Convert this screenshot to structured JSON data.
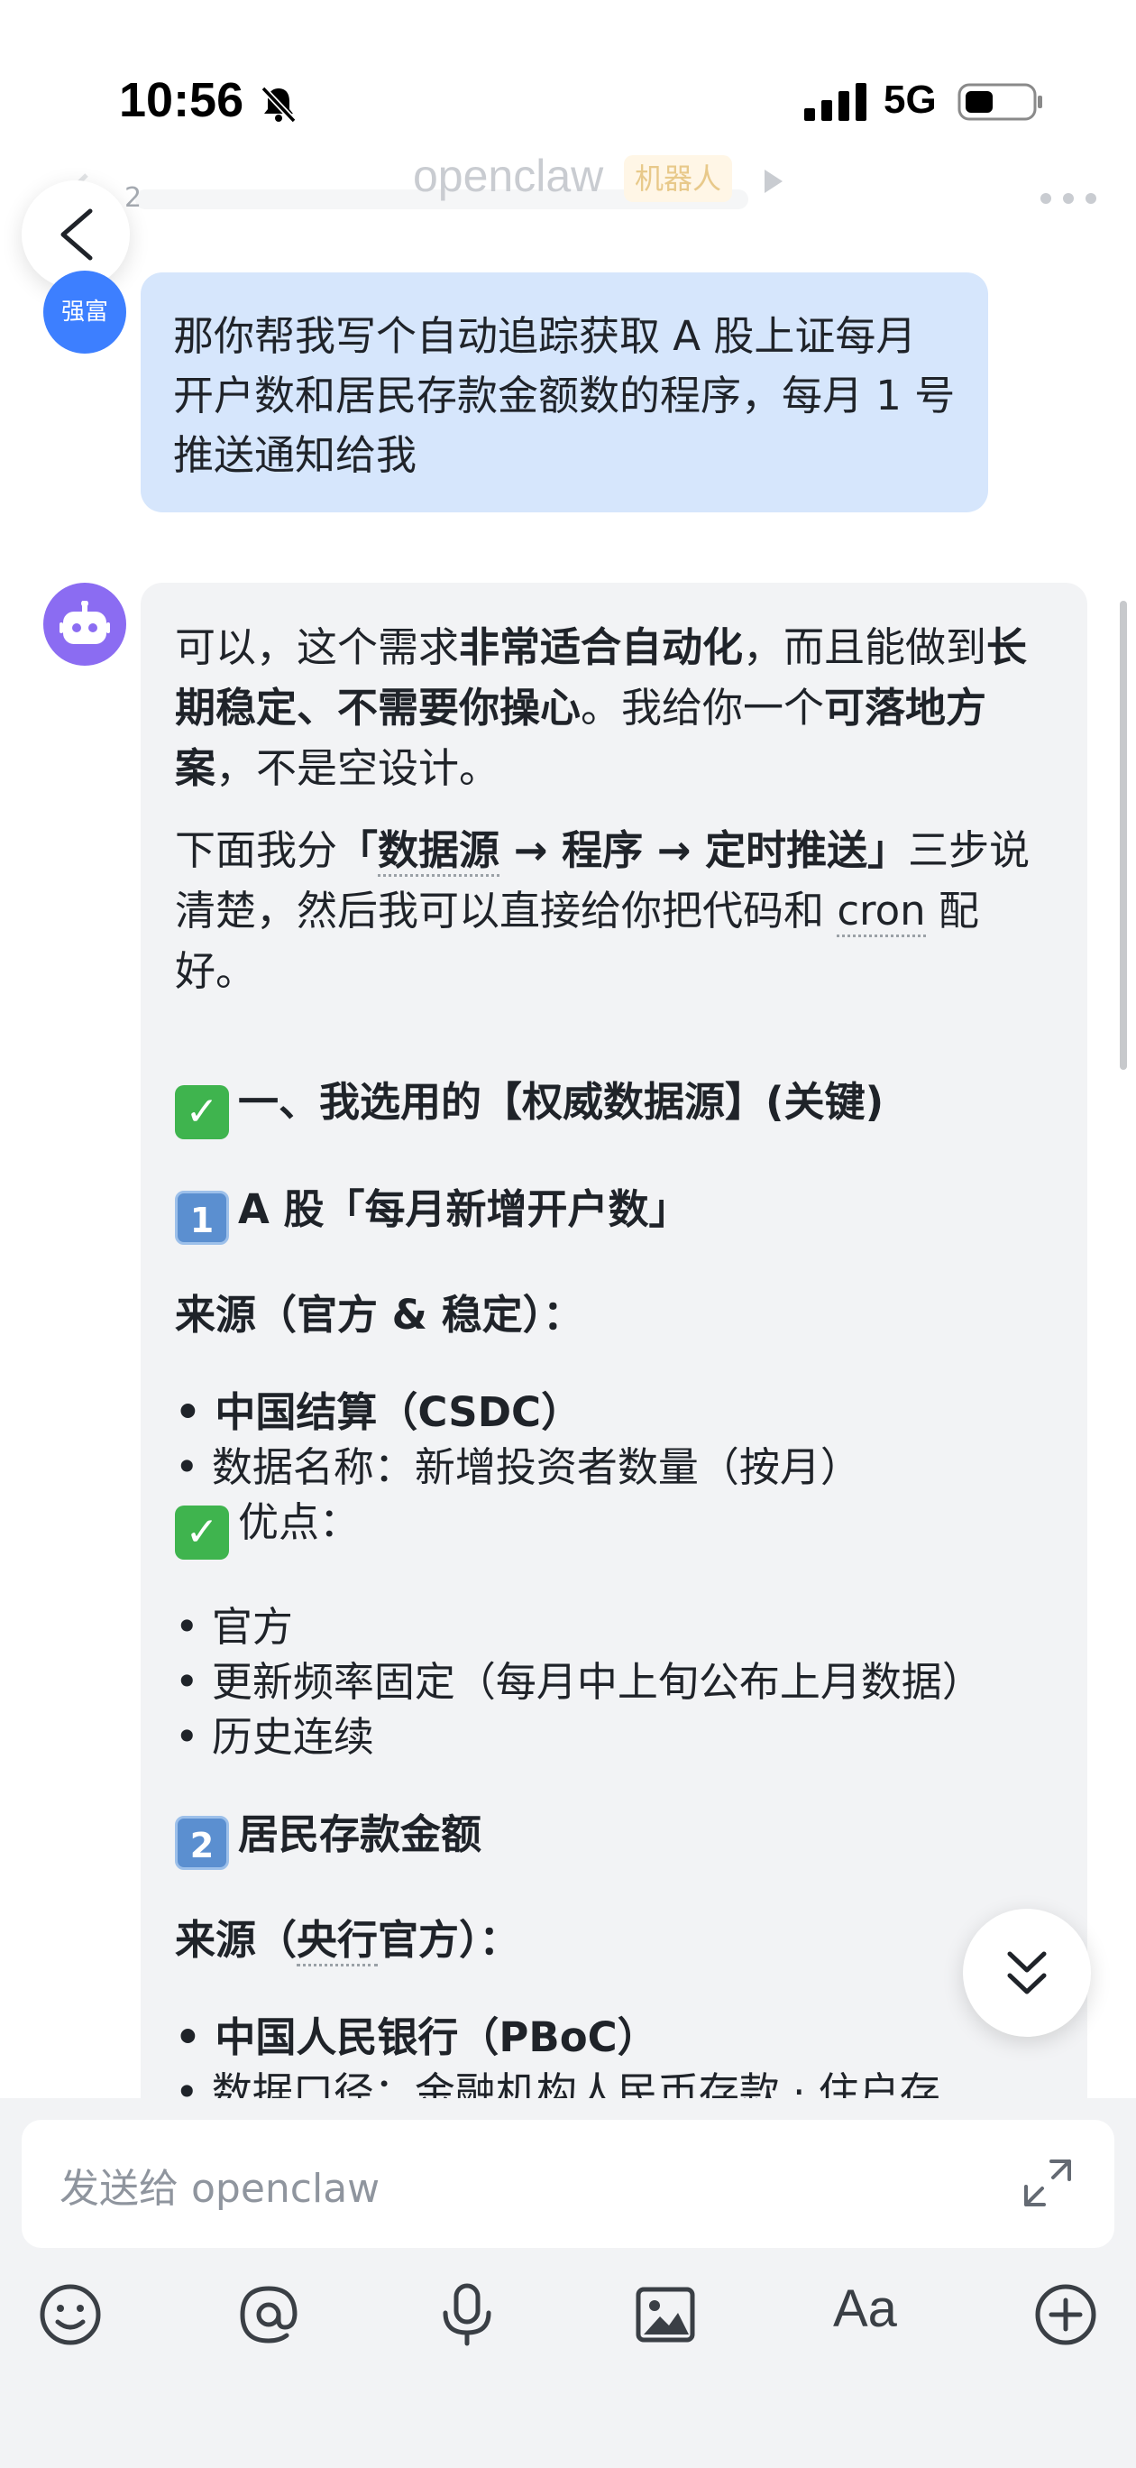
{
  "status_bar": {
    "time": "10:56",
    "network": "5G"
  },
  "header": {
    "unread_count": "2",
    "title": "openclaw",
    "badge": "机器人"
  },
  "user_message": {
    "avatar_text": "强富",
    "text": "那你帮我写个自动追踪获取 A 股上证每月开户数和居民存款金额数的程序，每月 1 号推送通知给我"
  },
  "bot_message": {
    "p1": {
      "a": "可以，这个需求",
      "b": "非常适合自动化",
      "c": "，而且能做到",
      "d": "长期稳定、不需要你操心",
      "e": "。我给你一个",
      "f": "可落地方案",
      "g": "，不是空设计。"
    },
    "p2": {
      "a": "下面我分",
      "b_pre": "「",
      "b_link": "数据源",
      "b_post": " → 程序 → 定时推送」",
      "c": "三步说清楚，然后我可以直接给你把代码和 ",
      "cron": "cron",
      "d": " 配好。"
    },
    "section1": {
      "emoji": "✓",
      "title": "一、我选用的【权威数据源】(关键)"
    },
    "item1": {
      "num": "1",
      "title": "A 股「每月新增开户数」",
      "source_title": "来源（官方 & 稳定）：",
      "lines": [
        "• 中国结算（CSDC）",
        "• 数据名称：新增投资者数量（按月）"
      ],
      "pros_emoji": "✓",
      "pros_label": "优点：",
      "pros": [
        "• 官方",
        "• 更新频率固定（每月中上旬公布上月数据）",
        "• 历史连续"
      ]
    },
    "item2": {
      "num": "2",
      "title": "居民存款金额",
      "source_pre": "来源（",
      "source_link": "央行",
      "source_post": "官方）：",
      "lines": [
        "• 中国人民银行（PBoC）",
        "• 数据口径：金融机构人民币存款 · 住户存"
      ]
    }
  },
  "input": {
    "placeholder": "发送给 openclaw"
  },
  "toolbar": {
    "font_label": "Aa"
  }
}
